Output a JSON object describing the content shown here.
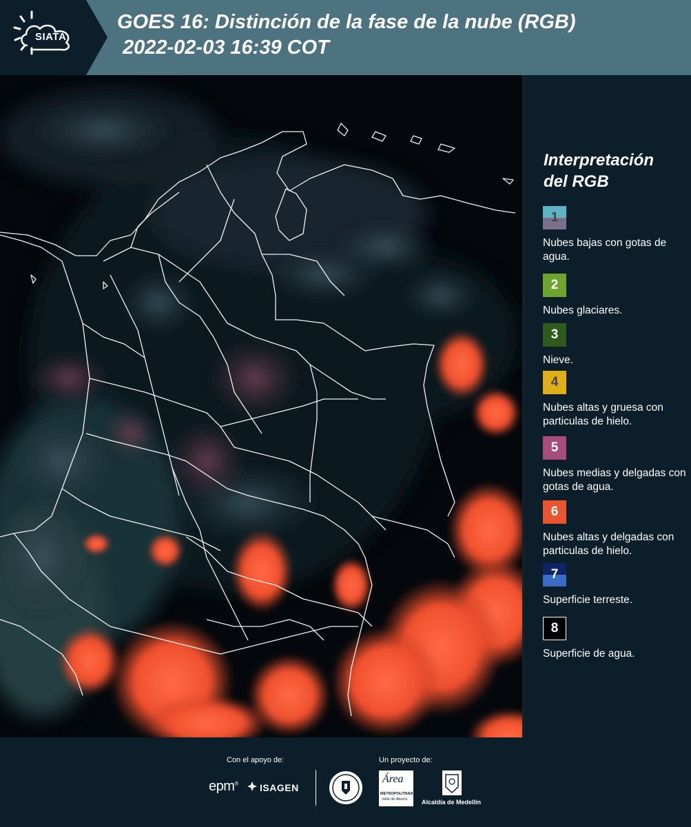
{
  "header": {
    "logo_text": "SIATA",
    "title_line1": "GOES 16: Distinción de la fase de la nube (RGB)",
    "title_line2": "2022-02-03 16:39 COT",
    "background_color": "#4d7380"
  },
  "map": {
    "description_icon": "satellite-rgb-composite-map",
    "background_color": "#04080c",
    "border_color": "#ffffff"
  },
  "legend": {
    "title_line1": "Interpretación",
    "title_line2": "del RGB",
    "items": [
      {
        "number": "1",
        "label": "Nubes bajas con gotas de agua.",
        "color_top": "#5fb3c4",
        "color_bottom": "#7a6e8c",
        "number_color": "#444444"
      },
      {
        "number": "2",
        "label": "Nubes glaciares.",
        "color_top": "#6ea52e",
        "color_bottom": "#6ea52e",
        "number_color": "#ffffff"
      },
      {
        "number": "3",
        "label": "Nieve.",
        "color_top": "#2e5a1c",
        "color_bottom": "#2e5a1c",
        "number_color": "#ffffff"
      },
      {
        "number": "4",
        "label": "Nubes altas y gruesa con particulas de hielo.",
        "color_top": "#e0ae1a",
        "color_bottom": "#e0ae1a",
        "number_color": "#444444"
      },
      {
        "number": "5",
        "label": "Nubes medias y delgadas con gotas de agua.",
        "color_top": "#a64d7c",
        "color_bottom": "#a64d7c",
        "number_color": "#ffffff"
      },
      {
        "number": "6",
        "label": "Nubes altas y delgadas con particulas de hielo.",
        "color_top": "#e8552e",
        "color_bottom": "#e8552e",
        "number_color": "#ffffff"
      },
      {
        "number": "7",
        "label": "Superficie terreste.",
        "color_top": "#0e2466",
        "color_bottom": "#3a6cc6",
        "number_color": "#ffffff"
      },
      {
        "number": "8",
        "label": "Superficie de agua.",
        "color_top": "#000000",
        "color_bottom": "#000000",
        "number_color": "#ffffff"
      }
    ]
  },
  "footer": {
    "support_label": "Con el apoyo de:",
    "project_label": "Un proyecto de:",
    "epm_text": "epm",
    "isagen_text": "ISAGEN",
    "amva_text_1": "Área",
    "amva_text_2": "METROPOLITANA",
    "amva_text_3": "Valle de Aburrá",
    "alcaldia_text": "Alcaldía de Medellín"
  }
}
